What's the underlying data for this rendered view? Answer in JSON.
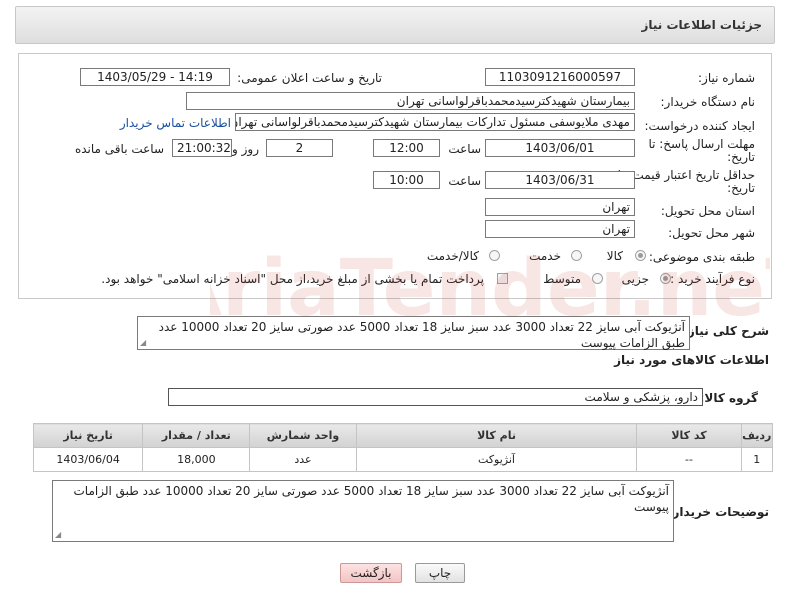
{
  "header": {
    "title": "جزئیات اطلاعات نیاز"
  },
  "form": {
    "need_number": {
      "label": "شماره نیاز:",
      "value": "1103091216000597"
    },
    "announce_datetime": {
      "label": "تاریخ و ساعت اعلان عمومی:",
      "value": "1403/05/29 - 14:19"
    },
    "buyer_org": {
      "label": "نام دستگاه خریدار:",
      "value": "بیمارستان شهیدکترسیدمحمدباقرلواسانی تهران"
    },
    "requester": {
      "label": "ایجاد کننده درخواست:",
      "value": "مهدی ملایوسفی مسئول تدارکات بیمارستان شهیدکترسیدمحمدباقرلواسانی تهران",
      "contact_link": "اطلاعات تماس خریدار"
    },
    "reply_deadline": {
      "label_line1": "مهلت ارسال پاسخ: تا",
      "label_line2": "تاریخ:",
      "date": "1403/06/01",
      "time_label": "ساعت",
      "time": "12:00",
      "days": "2",
      "days_label": "روز و",
      "remaining": "21:00:32",
      "remaining_label": "ساعت باقی مانده"
    },
    "price_validity": {
      "label_line1": "حداقل تاریخ اعتبار قیمت: تا",
      "label_line2": "تاریخ:",
      "date": "1403/06/31",
      "time_label": "ساعت",
      "time": "10:00"
    },
    "delivery_province": {
      "label": "استان محل تحویل:",
      "value": "تهران"
    },
    "delivery_city": {
      "label": "شهر محل تحویل:",
      "value": "تهران"
    },
    "category": {
      "label": "طبقه بندی موضوعی:",
      "options": [
        "کالا",
        "خدمت",
        "کالا/خدمت"
      ],
      "selected": "کالا"
    },
    "purchase_process": {
      "label": "نوع فرآیند خرید :",
      "options": [
        "جزیی",
        "متوسط"
      ],
      "selected": "جزیی",
      "note": "پرداخت تمام یا بخشی از مبلغ خرید،از محل \"اسناد خزانه اسلامی\" خواهد بود."
    }
  },
  "summary": {
    "label": "شرح کلی نیاز:",
    "value": "آنژیوکت آبی سایز 22 تعداد 3000 عدد سبز سایز 18 تعداد 5000 عدد صورتی سایز 20 تعداد 10000 عدد طبق الزامات پیوست"
  },
  "goods": {
    "section_title": "اطلاعات کالاهای مورد نیاز",
    "group_label": "گروه کالا:",
    "group_value": "دارو، پزشکی و سلامت",
    "columns": [
      "ردیف",
      "کد کالا",
      "نام کالا",
      "واحد شمارش",
      "تعداد / مقدار",
      "تاریخ نیاز"
    ],
    "rows": [
      {
        "row": "1",
        "code": "--",
        "name": "آنژیوکت",
        "unit": "عدد",
        "qty": "18,000",
        "date": "1403/06/04"
      }
    ]
  },
  "buyer_notes": {
    "label": "توضیحات خریدار:",
    "value": "آنژیوکت آبی سایز 22 تعداد 3000 عدد سبز سایز 18 تعداد 5000 عدد صورتی سایز 20 تعداد 10000 عدد طبق الزامات پیوست"
  },
  "buttons": {
    "print": "چاپ",
    "back": "بازگشت"
  },
  "watermark": {
    "text": "AriaTender.neT"
  }
}
